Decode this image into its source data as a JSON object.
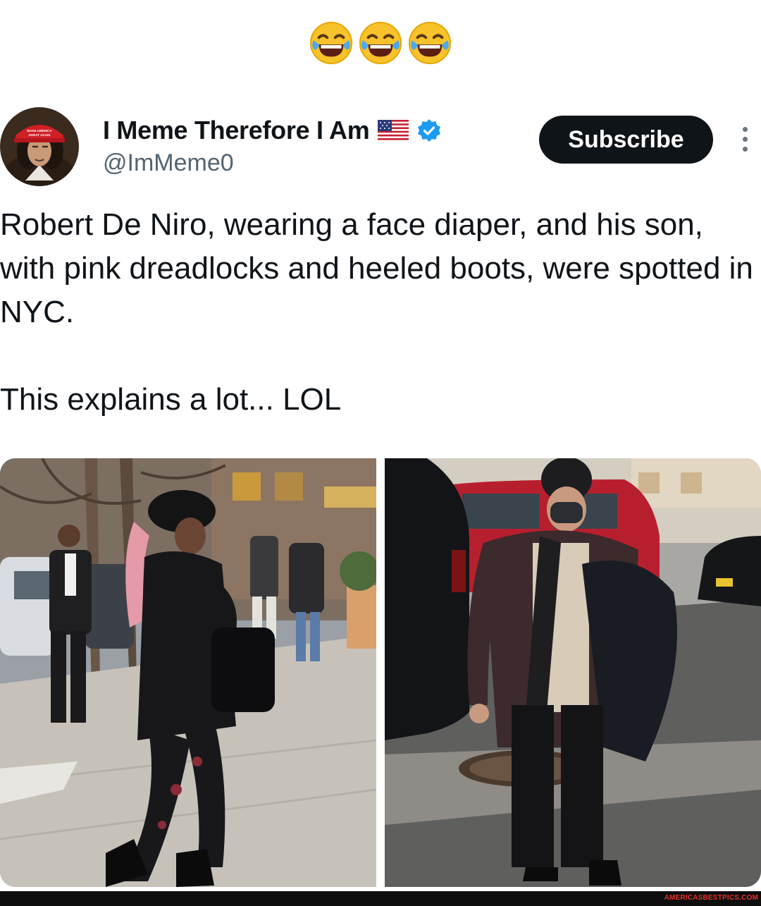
{
  "header": {
    "emoji_count": 3,
    "emoji_icon": "face-with-tears-of-joy-icon"
  },
  "author": {
    "name": "I Meme Therefore I Am",
    "handle": "@ImMeme0",
    "flag_icon": "us-flag-icon",
    "verified_icon": "verified-badge-icon",
    "verified_color": "#1d9bf0",
    "avatar_hat_text": "MAKE AMERICA GREAT AGAIN"
  },
  "actions": {
    "subscribe_label": "Subscribe",
    "more_icon": "more-vertical-icon"
  },
  "tweet": {
    "line1": "Robert De Niro, wearing a face diaper, and his son, with pink dreadlocks and heeled boots, were spotted in NYC.",
    "line2": "This explains a lot... LOL"
  },
  "media": [
    {
      "alt": "photo-woman-pink-dreadlocks"
    },
    {
      "alt": "photo-man-face-mask"
    }
  ],
  "watermark": "AMERICASBESTPICS.COM",
  "colors": {
    "text": "#0f1419",
    "secondary": "#536471",
    "button_bg": "#0f1419",
    "watermark": "#e0332d"
  }
}
